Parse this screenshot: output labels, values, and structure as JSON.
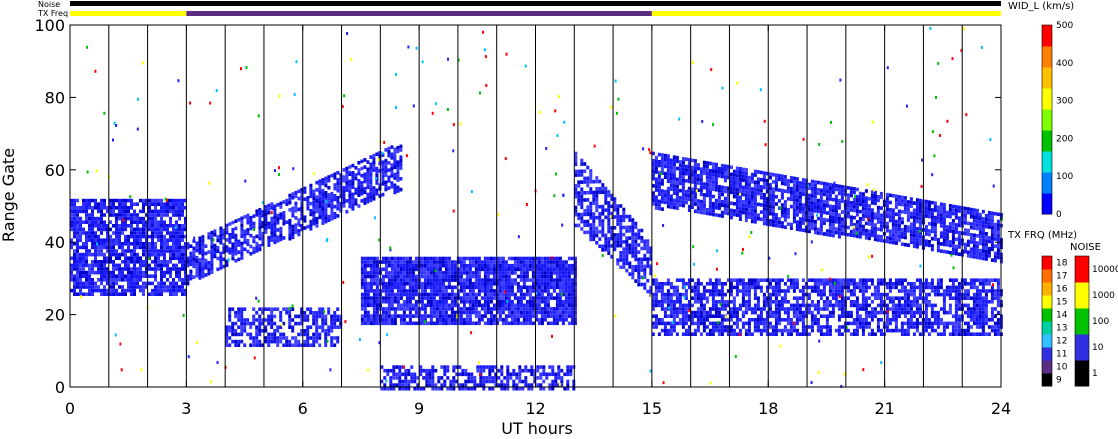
{
  "chart_data": {
    "type": "heatmap",
    "title": "",
    "xlabel": "UT hours",
    "ylabel": "Range Gate",
    "xlim": [
      0,
      24
    ],
    "ylim": [
      0,
      100
    ],
    "x_ticks": [
      "0",
      "3",
      "6",
      "9",
      "12",
      "15",
      "18",
      "21",
      "24"
    ],
    "y_ticks": [
      "0",
      "20",
      "40",
      "60",
      "80",
      "100"
    ],
    "grid_vertical_hours_every": 1,
    "status_bars": {
      "noise_label": "Noise",
      "txfreq_label": "TX Freq",
      "txfreq_segments": [
        {
          "start": 0,
          "end": 3,
          "color": "#ffff00"
        },
        {
          "start": 3,
          "end": 15,
          "color": "#5a2d82"
        },
        {
          "start": 15,
          "end": 24,
          "color": "#ffff00"
        }
      ]
    },
    "scatter_regions": [
      {
        "name": "early-band",
        "x": [
          0,
          3
        ],
        "y": [
          26,
          52
        ],
        "density": 0.8
      },
      {
        "name": "rising-arc-1",
        "x": [
          3,
          8.5
        ],
        "y_start": [
          29,
          40
        ],
        "y_end": [
          55,
          68
        ],
        "density": 0.7
      },
      {
        "name": "mid-band",
        "x": [
          7.5,
          13
        ],
        "y": [
          18,
          36
        ],
        "density": 0.9
      },
      {
        "name": "lower-band",
        "x": [
          4,
          7
        ],
        "y": [
          12,
          22
        ],
        "density": 0.6
      },
      {
        "name": "ground-scatter",
        "x": [
          8,
          13
        ],
        "y": [
          0,
          6
        ],
        "density": 0.6
      },
      {
        "name": "post-dawn-arc",
        "x": [
          13,
          15
        ],
        "y_start": [
          45,
          65
        ],
        "y_end": [
          25,
          40
        ],
        "density": 0.7
      },
      {
        "name": "late-band-upper",
        "x": [
          15,
          24
        ],
        "y_start": [
          50,
          65
        ],
        "y_end": [
          35,
          48
        ],
        "density": 0.8
      },
      {
        "name": "late-band-lower",
        "x": [
          15,
          24
        ],
        "y": [
          15,
          30
        ],
        "density": 0.7
      }
    ],
    "colorbars": [
      {
        "title": "WID_L (km/s)",
        "ticks": [
          "0",
          "100",
          "200",
          "300",
          "400",
          "500"
        ],
        "colors": [
          "#0000ff",
          "#0080ff",
          "#00e0e0",
          "#00c000",
          "#80ff00",
          "#ffff00",
          "#ffc000",
          "#ff8000",
          "#ff0000"
        ]
      },
      {
        "title": "TX FRQ (MHz)",
        "ticks": [
          "9",
          "10",
          "11",
          "12",
          "13",
          "14",
          "15",
          "16",
          "17",
          "18"
        ],
        "colors": [
          "#000000",
          "#5a2d82",
          "#3030e0",
          "#30c0ff",
          "#00d0a0",
          "#00c000",
          "#ffff00",
          "#ffb000",
          "#ff7000",
          "#ff0000"
        ]
      },
      {
        "title": "NOISE",
        "ticks": [
          "1",
          "10",
          "100",
          "1000",
          "10000"
        ],
        "colors": [
          "#000000",
          "#3030e0",
          "#00c000",
          "#ffff00",
          "#ff0000"
        ]
      }
    ]
  }
}
